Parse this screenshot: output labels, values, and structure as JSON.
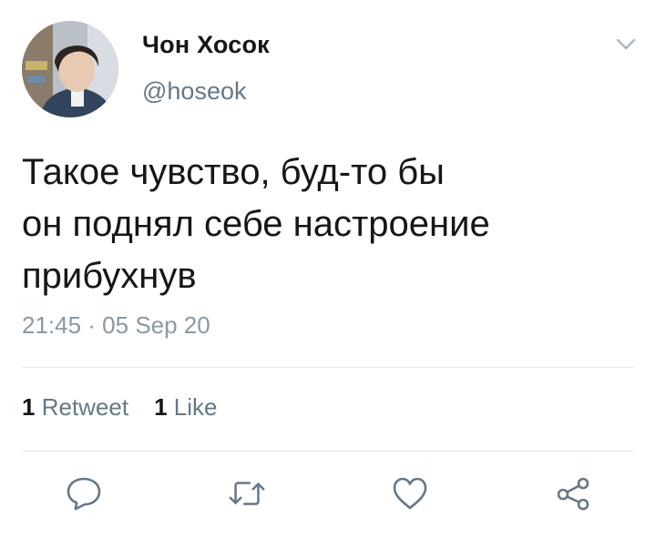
{
  "user": {
    "display_name": "Чон Хосок",
    "handle": "@hoseok",
    "avatar_icon": "profile-photo"
  },
  "tweet": {
    "lines": [
      "Такое чувство, буд-то бы",
      "он поднял себе настроение",
      "прибухнув"
    ],
    "timestamp": "21:45 · 05 Sep 20"
  },
  "stats": {
    "retweet_count": "1",
    "retweet_label": "Retweet",
    "like_count": "1",
    "like_label": "Like"
  },
  "actions": [
    "reply-icon",
    "retweet-icon",
    "like-icon",
    "share-icon"
  ],
  "colors": {
    "text": "#14171a",
    "secondary": "#657786",
    "timestamp": "#8899a6",
    "divider": "#e1e8ed",
    "icon": "#657786"
  }
}
